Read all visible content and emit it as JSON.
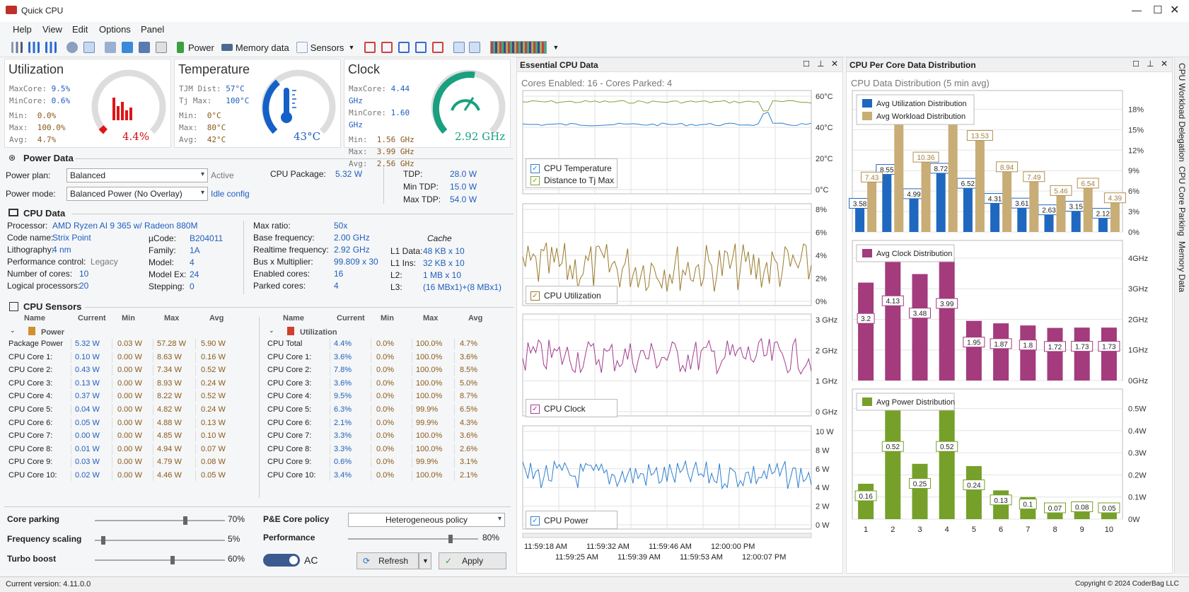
{
  "window": {
    "title": "Quick CPU"
  },
  "menu": [
    "Help",
    "View",
    "Edit",
    "Options",
    "Panel"
  ],
  "toolbar": {
    "power": "Power",
    "memory": "Memory data",
    "sensors": "Sensors"
  },
  "gauges": {
    "util": {
      "title": "Utilization",
      "l1": "MaxCore:",
      "v1": "9.5%",
      "l2": "MinCore:",
      "v2": "0.6%",
      "l3": "Min:",
      "v3": "0.0%",
      "l4": "Max:",
      "v4": "100.0%",
      "l5": "Avg:",
      "v5": "4.7%",
      "value": "4.4%"
    },
    "temp": {
      "title": "Temperature",
      "l1": "TJM Dist:",
      "v1": "57°C",
      "l2": "Tj Max:",
      "v2": "100°C",
      "l3": "Min:",
      "v3": "0°C",
      "l4": "Max:",
      "v4": "80°C",
      "l5": "Avg:",
      "v5": "42°C",
      "value": "43°C"
    },
    "clock": {
      "title": "Clock",
      "l1": "MaxCore:",
      "v1": "4.44 GHz",
      "l2": "MinCore:",
      "v2": "1.60 GHz",
      "l3": "Min:",
      "v3": "1.56 GHz",
      "l4": "Max:",
      "v4": "3.99 GHz",
      "l5": "Avg:",
      "v5": "2.56 GHz",
      "value": "2.92 GHz"
    }
  },
  "power": {
    "section": "Power Data",
    "plan_label": "Power plan:",
    "plan": "Balanced",
    "active": "Active",
    "mode_label": "Power mode:",
    "mode": "Balanced Power (No Overlay)",
    "idle": "Idle config",
    "pkg_label": "CPU Package:",
    "pkg": "5.32 W",
    "tdp_label": "TDP:",
    "tdp": "28.0 W",
    "mintdp_label": "Min TDP:",
    "mintdp": "15.0 W",
    "maxtdp_label": "Max TDP:",
    "maxtdp": "54.0 W"
  },
  "cpu": {
    "section": "CPU Data",
    "c1": [
      [
        "Processor:",
        "AMD Ryzen AI 9 365 w/ Radeon 880M"
      ],
      [
        "Code name:",
        "Strix Point"
      ],
      [
        "Lithography:",
        "4 nm"
      ],
      [
        "Performance control:",
        "Legacy"
      ],
      [
        "Number of cores:",
        "10"
      ],
      [
        "Logical processors:",
        "20"
      ]
    ],
    "c2": [
      [
        "µCode:",
        "B204011"
      ],
      [
        "Family:",
        "1A"
      ],
      [
        "Model:",
        "4"
      ],
      [
        "Model Ex:",
        "24"
      ],
      [
        "Stepping:",
        "0"
      ]
    ],
    "c3": [
      [
        "Max ratio:",
        "50x"
      ],
      [
        "Base frequency:",
        "2.00 GHz"
      ],
      [
        "Realtime frequency:",
        "2.92 GHz"
      ],
      [
        "Bus x Multiplier:",
        "99.809 x 30"
      ],
      [
        "Enabled cores:",
        "16"
      ],
      [
        "Parked cores:",
        "4"
      ]
    ],
    "cache_title": "Cache",
    "c4": [
      [
        "L1 Data:",
        "48 KB x 10"
      ],
      [
        "L1 Ins:",
        "32 KB x 10"
      ],
      [
        "L2:",
        "1 MB x 10"
      ],
      [
        "L3:",
        "(16 MBx1)+(8 MBx1)"
      ]
    ]
  },
  "sensors": {
    "section": "CPU Sensors",
    "headers": [
      "Name",
      "Current",
      "Min",
      "Max",
      "Avg"
    ],
    "power_group": "Power",
    "util_group": "Utilization",
    "power_rows": [
      [
        "Package Power",
        "5.32 W",
        "0.03 W",
        "57.28 W",
        "5.90 W"
      ],
      [
        "CPU Core 1:",
        "0.10 W",
        "0.00 W",
        "8.63 W",
        "0.16 W"
      ],
      [
        "CPU Core 2:",
        "0.43 W",
        "0.00 W",
        "7.34 W",
        "0.52 W"
      ],
      [
        "CPU Core 3:",
        "0.13 W",
        "0.00 W",
        "8.93 W",
        "0.24 W"
      ],
      [
        "CPU Core 4:",
        "0.37 W",
        "0.00 W",
        "8.22 W",
        "0.52 W"
      ],
      [
        "CPU Core 5:",
        "0.04 W",
        "0.00 W",
        "4.82 W",
        "0.24 W"
      ],
      [
        "CPU Core 6:",
        "0.05 W",
        "0.00 W",
        "4.88 W",
        "0.13 W"
      ],
      [
        "CPU Core 7:",
        "0.00 W",
        "0.00 W",
        "4.85 W",
        "0.10 W"
      ],
      [
        "CPU Core 8:",
        "0.01 W",
        "0.00 W",
        "4.94 W",
        "0.07 W"
      ],
      [
        "CPU Core 9:",
        "0.03 W",
        "0.00 W",
        "4.79 W",
        "0.08 W"
      ],
      [
        "CPU Core 10:",
        "0.02 W",
        "0.00 W",
        "4.46 W",
        "0.05 W"
      ]
    ],
    "util_rows": [
      [
        "CPU Total",
        "4.4%",
        "0.0%",
        "100.0%",
        "4.7%"
      ],
      [
        "CPU Core 1:",
        "3.6%",
        "0.0%",
        "100.0%",
        "3.6%"
      ],
      [
        "CPU Core 2:",
        "7.8%",
        "0.0%",
        "100.0%",
        "8.5%"
      ],
      [
        "CPU Core 3:",
        "3.6%",
        "0.0%",
        "100.0%",
        "5.0%"
      ],
      [
        "CPU Core 4:",
        "9.5%",
        "0.0%",
        "100.0%",
        "8.7%"
      ],
      [
        "CPU Core 5:",
        "6.3%",
        "0.0%",
        "99.9%",
        "6.5%"
      ],
      [
        "CPU Core 6:",
        "2.1%",
        "0.0%",
        "99.9%",
        "4.3%"
      ],
      [
        "CPU Core 7:",
        "3.3%",
        "0.0%",
        "100.0%",
        "3.6%"
      ],
      [
        "CPU Core 8:",
        "3.3%",
        "0.0%",
        "100.0%",
        "2.6%"
      ],
      [
        "CPU Core 9:",
        "0.6%",
        "0.0%",
        "99.9%",
        "3.1%"
      ],
      [
        "CPU Core 10:",
        "3.4%",
        "0.0%",
        "100.0%",
        "2.1%"
      ]
    ]
  },
  "controls": {
    "core_parking": "Core parking",
    "core_parking_val": "70%",
    "core_parking_level": 0.7,
    "freq": "Frequency scaling",
    "freq_val": "5%",
    "freq_level": 0.05,
    "turbo": "Turbo boost",
    "turbo_val": "60%",
    "turbo_level": 0.6,
    "pe_policy": "P&E Core policy",
    "pe_value": "Heterogeneous policy",
    "perf": "Performance",
    "perf_val": "80%",
    "perf_level": 0.8,
    "ac": "AC",
    "refresh": "Refresh",
    "apply": "Apply"
  },
  "essential": {
    "title": "Essential CPU Data",
    "subtitle": "Cores Enabled: 16 - Cores Parked: 4",
    "temp_ticks": [
      "60°C",
      "40°C",
      "20°C",
      "0°C"
    ],
    "temp_legend": [
      "CPU Temperature",
      "Distance to Tj Max"
    ],
    "util_ticks": [
      "8%",
      "6%",
      "4%",
      "2%",
      "0%"
    ],
    "util_legend": "CPU Utilization",
    "clock_ticks": [
      "3 GHz",
      "2 GHz",
      "1 GHz",
      "0 GHz"
    ],
    "clock_legend": "CPU Clock",
    "power_ticks": [
      "10 W",
      "8 W",
      "6 W",
      "4 W",
      "2 W",
      "0 W"
    ],
    "power_legend": "CPU Power",
    "time_top": [
      "11:59:18 AM",
      "11:59:32 AM",
      "11:59:46 AM",
      "12:00:00 PM"
    ],
    "time_bottom": [
      "11:59:25 AM",
      "11:59:39 AM",
      "11:59:53 AM",
      "12:00:07 PM"
    ]
  },
  "percore": {
    "title": "CPU Per Core Data Distribution",
    "subtitle": "CPU Data Distribution (5 min avg)"
  },
  "chart_data": [
    {
      "type": "bar",
      "title": "",
      "legend": [
        "Avg Utilization Distribution",
        "Avg Workload Distribution"
      ],
      "categories": [
        "1",
        "2",
        "3",
        "4",
        "5",
        "6",
        "7",
        "8",
        "9",
        "10"
      ],
      "series": [
        {
          "name": "Avg Utilization Distribution",
          "values": [
            3.58,
            8.55,
            4.99,
            8.72,
            6.52,
            4.31,
            3.61,
            2.63,
            3.15,
            2.12
          ]
        },
        {
          "name": "Avg Workload Distribution",
          "values": [
            7.43,
            17.75,
            10.36,
            18.1,
            13.53,
            8.94,
            7.49,
            5.46,
            6.54,
            4.39
          ]
        }
      ],
      "yticks": [
        "18%",
        "15%",
        "12%",
        "9%",
        "6%",
        "3%",
        "0%"
      ],
      "ylim": [
        0,
        19.5
      ]
    },
    {
      "type": "bar",
      "title": "",
      "legend": [
        "Avg Clock Distribution"
      ],
      "categories": [
        "1",
        "2",
        "3",
        "4",
        "5",
        "6",
        "7",
        "8",
        "9",
        "10"
      ],
      "series": [
        {
          "name": "Avg Clock Distribution",
          "values": [
            3.2,
            4.13,
            3.48,
            3.99,
            1.95,
            1.87,
            1.8,
            1.72,
            1.73,
            1.73
          ]
        }
      ],
      "yticks": [
        "4GHz",
        "3GHz",
        "2GHz",
        "1GHz",
        "0GHz"
      ],
      "ylim": [
        0,
        4.3
      ]
    },
    {
      "type": "bar",
      "title": "",
      "legend": [
        "Avg Power Distribution"
      ],
      "categories": [
        "1",
        "2",
        "3",
        "4",
        "5",
        "6",
        "7",
        "8",
        "9",
        "10"
      ],
      "series": [
        {
          "name": "Avg Power Distribution",
          "values": [
            0.16,
            0.52,
            0.25,
            0.52,
            0.24,
            0.13,
            0.1,
            0.07,
            0.08,
            0.05
          ]
        }
      ],
      "yticks": [
        "0.5W",
        "0.4W",
        "0.3W",
        "0.2W",
        "0.1W",
        "0W"
      ],
      "ylim": [
        0,
        0.55
      ]
    }
  ],
  "side_tabs": [
    "CPU Workload Delegation",
    "CPU Core Parking",
    "Memory Data"
  ],
  "status": {
    "version": "Current version:  4.11.0.0",
    "copyright": "Copyright © 2024 CoderBag LLC"
  },
  "colors": {
    "util_blue": "#1f68c0",
    "workload_tan": "#c8ad76",
    "clock_purple": "#a33b7d",
    "power_green": "#76a02a",
    "temp_line": "#7da33a",
    "util_line": "#9a7a2a",
    "clock_line": "#a33b8f",
    "power_line": "#2d7fd0"
  }
}
